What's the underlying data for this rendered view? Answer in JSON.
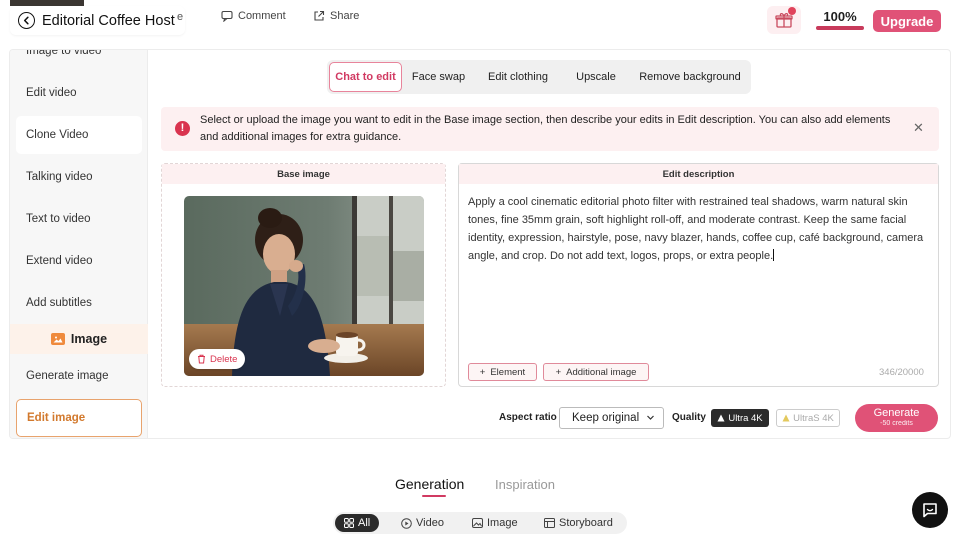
{
  "header": {
    "title": "Editorial Coffee Host",
    "stray_char": "e",
    "comment_label": "Comment",
    "share_label": "Share",
    "credits_percent": "100%",
    "credits_fraction": 1.0,
    "upgrade_label": "Upgrade"
  },
  "sidebar": {
    "items": [
      {
        "label": "Image to video"
      },
      {
        "label": "Edit video"
      },
      {
        "label": "Clone Video"
      },
      {
        "label": "Talking video"
      },
      {
        "label": "Text to video"
      },
      {
        "label": "Extend video"
      },
      {
        "label": "Add subtitles"
      }
    ],
    "section_title": "Image",
    "image_items": [
      {
        "label": "Generate image"
      },
      {
        "label": "Edit image",
        "active": true
      }
    ]
  },
  "tabs": [
    {
      "label": "Chat to edit",
      "active": true
    },
    {
      "label": "Face swap"
    },
    {
      "label": "Edit clothing"
    },
    {
      "label": "Upscale"
    },
    {
      "label": "Remove background"
    }
  ],
  "alert": {
    "text": "Select or upload the image you want to edit in the Base image section, then describe your edits in Edit description. You can also add elements and additional images for extra guidance."
  },
  "base_image": {
    "title": "Base image",
    "delete_label": "Delete"
  },
  "edit": {
    "title": "Edit description",
    "text": "Apply a cool cinematic editorial photo filter with restrained teal shadows, warm natural skin tones, fine 35mm grain, soft highlight roll-off, and moderate contrast. Keep the same facial identity, expression, hairstyle, pose, navy blazer, hands, coffee cup, café background, camera angle, and crop. Do not add text, logos, props, or extra people.",
    "element_label": "Element",
    "additional_label": "Additional image",
    "counter": "346/20000"
  },
  "controls": {
    "aspect_label": "Aspect ratio",
    "aspect_value": "Keep original",
    "quality_label": "Quality",
    "quality_options": [
      "Ultra 4K",
      "UltraS 4K"
    ],
    "generate_label": "Generate",
    "generate_sub": "-50 credits"
  },
  "lower": {
    "tabs": [
      "Generation",
      "Inspiration"
    ],
    "filters": [
      "All",
      "Video",
      "Image",
      "Storyboard"
    ]
  },
  "colors": {
    "accent": "#e05277",
    "accent_text": "#d13a62",
    "active_side": "#d2792d",
    "alert_bg": "#fdf0f1"
  },
  "icons": [
    "back-arrow-icon",
    "comment-icon",
    "share-icon",
    "gift-icon",
    "info-icon",
    "close-icon",
    "image-icon",
    "trash-icon",
    "plus-icon",
    "chevron-down-icon",
    "grid-icon",
    "video-icon",
    "storyboard-icon",
    "chat-icon"
  ]
}
